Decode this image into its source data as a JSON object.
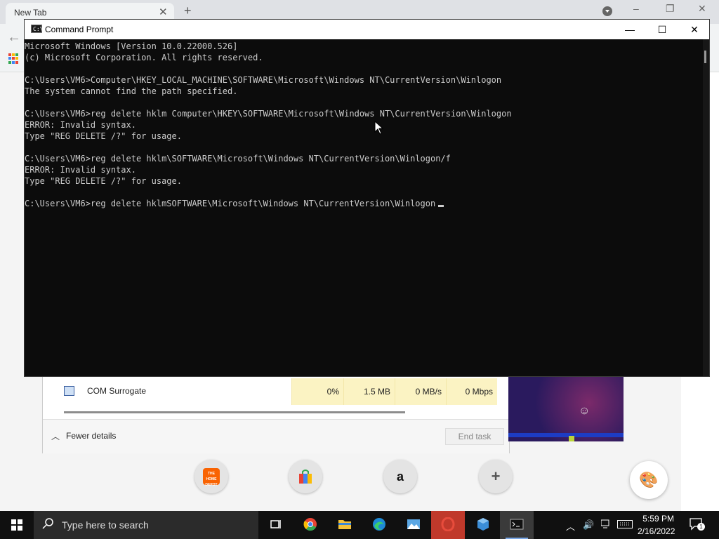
{
  "browser": {
    "tab_title": "New Tab",
    "tab_close": "✕",
    "new_tab": "+",
    "window_controls": [
      "–",
      "❐",
      "✕"
    ]
  },
  "taskmgr": {
    "process": {
      "name": "COM Surrogate",
      "cpu": "0%",
      "memory": "1.5 MB",
      "disk": "0 MB/s",
      "network": "0 Mbps"
    },
    "fewer_details": "Fewer details",
    "end_task": "End task"
  },
  "cmd": {
    "title": "Command Prompt",
    "controls": [
      "—",
      "☐",
      "✕"
    ],
    "lines": [
      "Microsoft Windows [Version 10.0.22000.526]",
      "(c) Microsoft Corporation. All rights reserved.",
      "",
      "C:\\Users\\VM6>Computer\\HKEY_LOCAL_MACHINE\\SOFTWARE\\Microsoft\\Windows NT\\CurrentVersion\\Winlogon",
      "The system cannot find the path specified.",
      "",
      "C:\\Users\\VM6>reg delete hklm Computer\\HKEY\\SOFTWARE\\Microsoft\\Windows NT\\CurrentVersion\\Winlogon",
      "ERROR: Invalid syntax.",
      "Type \"REG DELETE /?\" for usage.",
      "",
      "C:\\Users\\VM6>reg delete hklm\\SOFTWARE\\Microsoft\\Windows NT\\CurrentVersion\\Winlogon/f",
      "ERROR: Invalid syntax.",
      "Type \"REG DELETE /?\" for usage.",
      "",
      "C:\\Users\\VM6>reg delete hklmSOFTWARE\\Microsoft\\Windows NT\\CurrentVersion\\Winlogon"
    ]
  },
  "shortcuts": [
    {
      "name": "home-depot",
      "label": "THE HOME DEPOT"
    },
    {
      "name": "shopping-bag",
      "label": ""
    },
    {
      "name": "amazon",
      "label": "a"
    },
    {
      "name": "add-shortcut",
      "label": "+"
    }
  ],
  "taskbar": {
    "search_placeholder": "Type here to search",
    "apps": [
      "task-view",
      "chrome",
      "file-explorer",
      "edge",
      "photos",
      "opera",
      "app-cube",
      "command-prompt"
    ],
    "time": "5:59 PM",
    "date": "2/16/2022",
    "notification_count": "1"
  }
}
